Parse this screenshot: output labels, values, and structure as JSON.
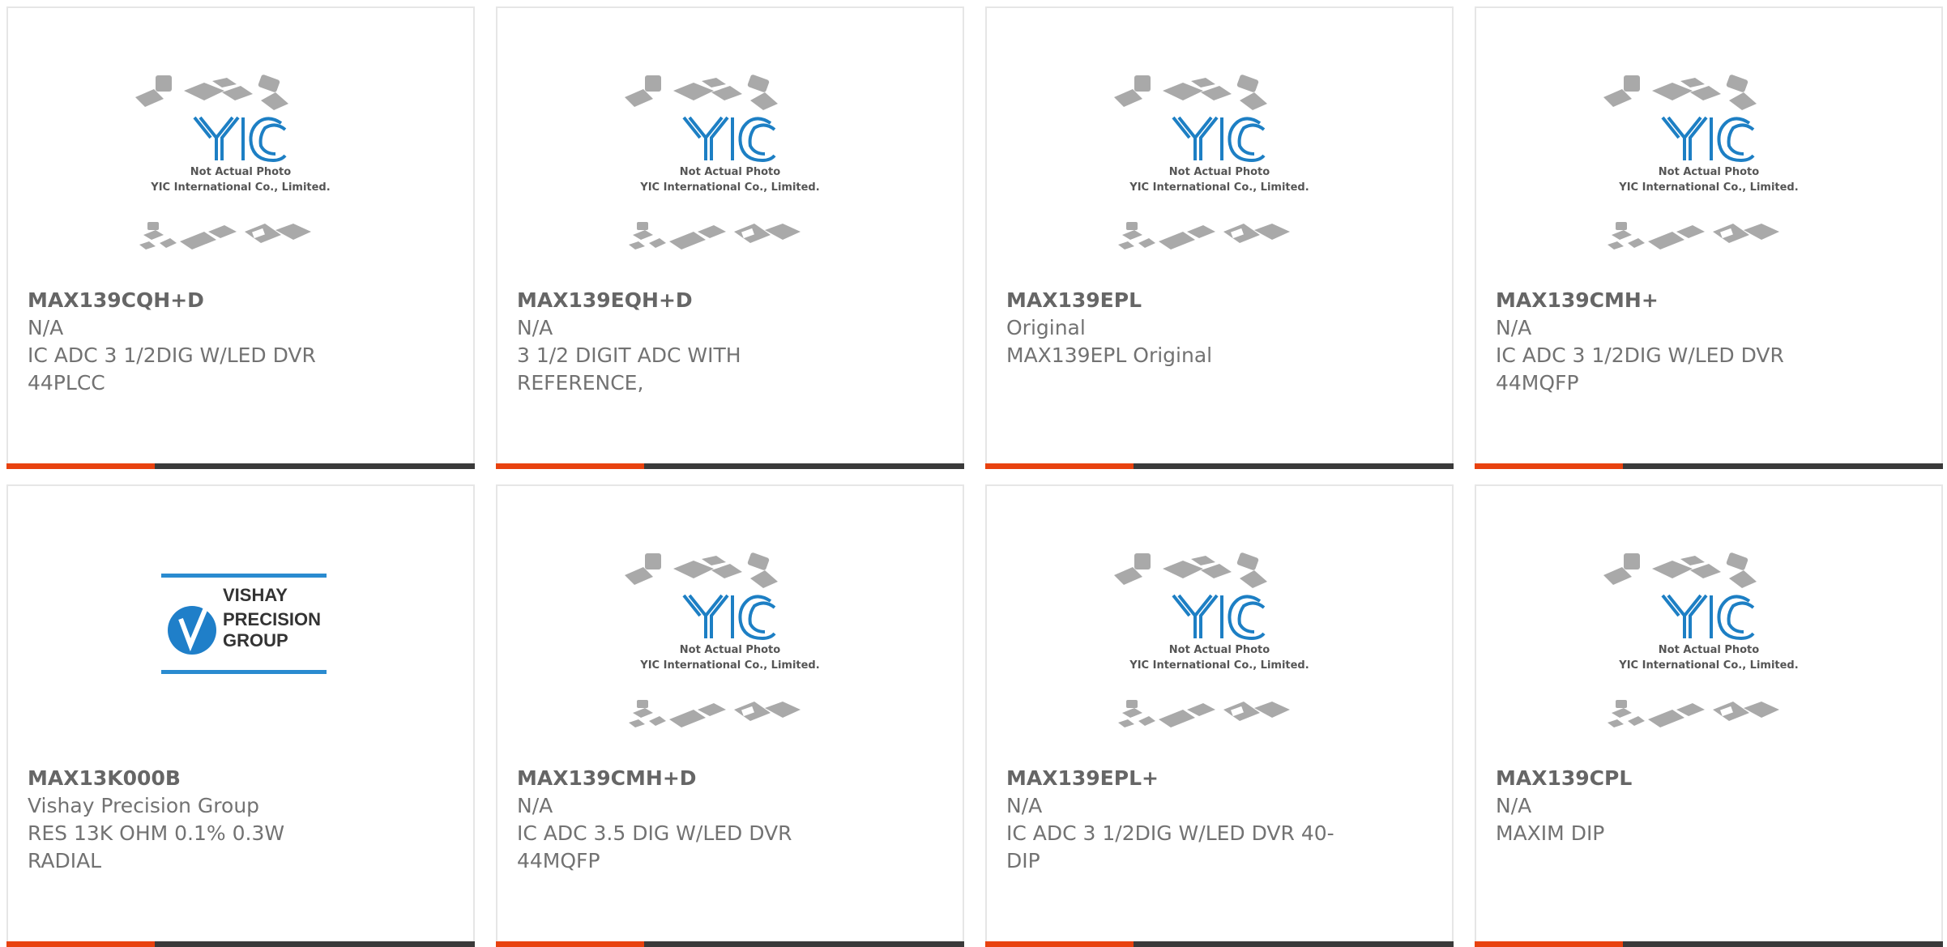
{
  "colors": {
    "accent": "#e8420f",
    "bar": "#3a3a3a",
    "text": "#6b6b6b",
    "yic_blue": "#1d7fc4"
  },
  "placeholder": {
    "caption_line1": "Not Actual Photo",
    "caption_line2": "YIC International Co., Limited.",
    "logo_text": "YIC"
  },
  "vishay_logo": {
    "line1": "VISHAY",
    "line2": "PRECISION",
    "line3": "GROUP"
  },
  "products": [
    {
      "part": "MAX139CQH+D",
      "mfr": "N/A",
      "desc": "IC ADC 3 1/2DIG W/LED DVR",
      "desc2": "44PLCC"
    },
    {
      "part": "MAX139EQH+D",
      "mfr": "N/A",
      "desc": "3 1/2 DIGIT ADC WITH",
      "desc2": "REFERENCE,"
    },
    {
      "part": "MAX139EPL",
      "mfr": "Original",
      "desc": "MAX139EPL Original",
      "desc2": ""
    },
    {
      "part": "MAX139CMH+",
      "mfr": "N/A",
      "desc": "IC ADC 3 1/2DIG W/LED DVR",
      "desc2": "44MQFP"
    },
    {
      "part": "MAX13K000B",
      "mfr": "Vishay Precision Group",
      "desc": "RES 13K OHM 0.1% 0.3W",
      "desc2": "RADIAL"
    },
    {
      "part": "MAX139CMH+D",
      "mfr": "N/A",
      "desc": "IC ADC 3.5 DIG W/LED DVR",
      "desc2": "44MQFP"
    },
    {
      "part": "MAX139EPL+",
      "mfr": "N/A",
      "desc": "IC ADC 3 1/2DIG W/LED DVR 40-",
      "desc2": "DIP"
    },
    {
      "part": "MAX139CPL",
      "mfr": "N/A",
      "desc": "MAXIM DIP",
      "desc2": ""
    }
  ]
}
